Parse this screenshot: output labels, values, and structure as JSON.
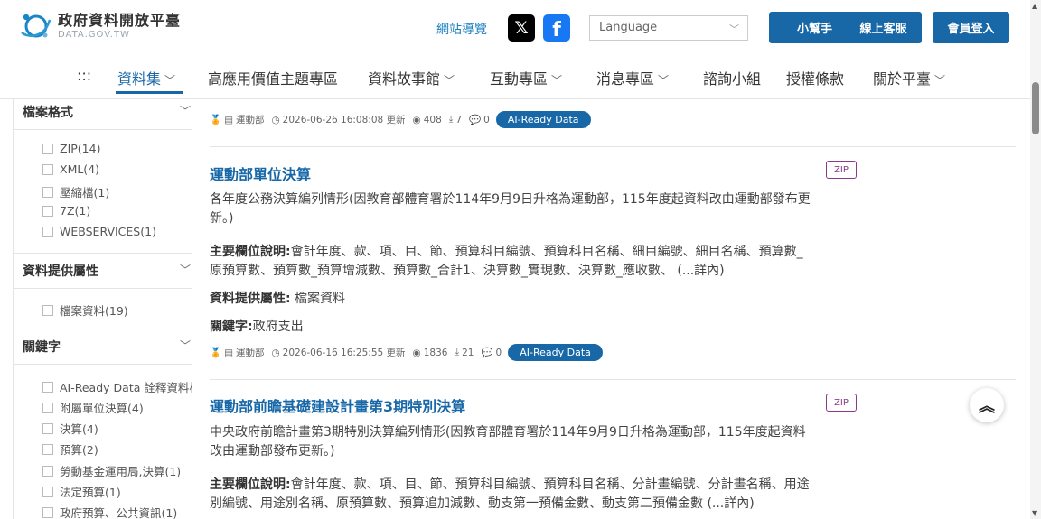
{
  "header": {
    "logo_zh": "政府資料開放平臺",
    "logo_en": "DATA.GOV.TW",
    "sitemap": "網站導覽",
    "x_label": "𝕏",
    "fb_label": "f",
    "language_placeholder": "Language",
    "buttons": {
      "helper": "小幫手",
      "service": "線上客服",
      "login": "會員登入"
    }
  },
  "nav": {
    "menu": ":::",
    "items": [
      {
        "label": "資料集",
        "dropdown": true,
        "active": true
      },
      {
        "label": "高應用價值主題專區",
        "dropdown": false
      },
      {
        "label": "資料故事館",
        "dropdown": true
      },
      {
        "label": "互動專區",
        "dropdown": true
      },
      {
        "label": "消息專區",
        "dropdown": true
      },
      {
        "label": "諮詢小組",
        "dropdown": false
      },
      {
        "label": "授權條款",
        "dropdown": false
      },
      {
        "label": "關於平臺",
        "dropdown": true
      }
    ]
  },
  "sidebar": {
    "format": {
      "title": "檔案格式",
      "options": [
        "ZIP(14)",
        "XML(4)",
        "壓縮檔(1)",
        "7Z(1)",
        "WEBSERVICES(1)"
      ]
    },
    "provider": {
      "title": "資料提供屬性",
      "options": [
        "檔案資料(19)"
      ]
    },
    "keywords": {
      "title": "關鍵字",
      "options": [
        "AI-Ready Data 詮釋資料框",
        "附屬單位決算(4)",
        "決算(4)",
        "預算(2)",
        "勞動基金運用局,決算(1)",
        "法定預算(1)",
        "政府預算、公共資訊(1)"
      ]
    }
  },
  "datasets": [
    {
      "agency": "運動部",
      "updated": "2026-06-26 16:08:08 更新",
      "views": "408",
      "downloads": "7",
      "comments": "0",
      "badge": "AI-Ready Data"
    },
    {
      "title": "運動部單位決算",
      "format": "ZIP",
      "description": "各年度公務決算編列情形(因教育部體育署於114年9月9日升格為運動部，115年度起資料改由運動部發布更新。)",
      "fields_label": "主要欄位說明:",
      "fields_value": "會計年度、款、項、目、節、預算科目編號、預算科目名稱、細目編號、細目名稱、預算數_原預算數、預算數_預算增減數、預算數_合計1、決算數_實現數、決算數_應收數、 (...詳內)",
      "provider_label": "資料提供屬性:",
      "provider_value": " 檔案資料",
      "keyword_label": "關鍵字:",
      "keyword_value": "政府支出",
      "agency": "運動部",
      "updated": "2026-06-16 16:25:55 更新",
      "views": "1836",
      "downloads": "21",
      "comments": "0",
      "badge": "AI-Ready Data"
    },
    {
      "title": "運動部前瞻基礎建設計畫第3期特別決算",
      "format": "ZIP",
      "description": "中央政府前瞻計畫第3期特別決算編列情形(因教育部體育署於114年9月9日升格為運動部，115年度起資料改由運動部發布更新。)",
      "fields_label": "主要欄位說明:",
      "fields_value": "會計年度、款、項、目、節、預算科目編號、預算科目名稱、分計畫編號、分計畫名稱、用途別編號、用途別名稱、原預算數、預算追加減數、動支第一預備金數、動支第二預備金數 (...詳內)"
    }
  ],
  "scroll_top": "︽",
  "colors": {
    "primary": "#1868a8",
    "zip_tag": "#8a3a8a",
    "badge_medal": "#e0a020"
  }
}
